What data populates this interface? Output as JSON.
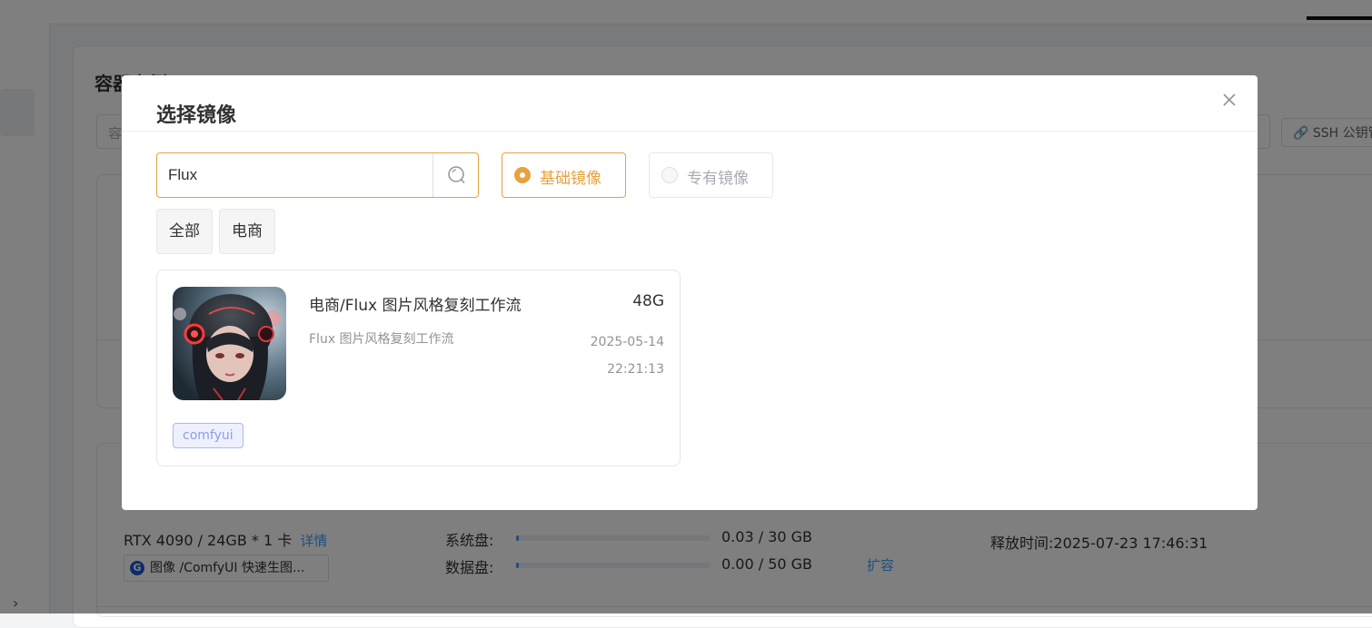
{
  "background": {
    "page_title": "容器实例",
    "filter_placeholder": "容",
    "ssh_button": "SSH 公钥管理",
    "instance": {
      "gpu": "RTX 4090 / 24GB  *  1 卡",
      "detail_link": "详情",
      "image_chip": "图像 /ComfyUI 快速生图...",
      "system_disk_label": "系统盘:",
      "system_disk_value": "0.03 / 30 GB",
      "system_disk_usage": 0.001,
      "data_disk_label": "数据盘:",
      "data_disk_value": "0.00 / 50 GB",
      "data_disk_usage": 0.0,
      "expand_link": "扩容",
      "release_time": "释放时间:2025-07-23 17:46:31"
    }
  },
  "dialog": {
    "title": "选择镜像",
    "search_value": "Flux",
    "radios": [
      {
        "label": "基础镜像",
        "checked": true
      },
      {
        "label": "专有镜像",
        "checked": false
      }
    ],
    "categories": [
      "全部",
      "电商"
    ],
    "results": [
      {
        "title": "电商/Flux 图片风格复刻工作流",
        "size": "48G",
        "description": "Flux 图片风格复刻工作流",
        "date": "2025-05-14",
        "time": "22:21:13",
        "tag": "comfyui"
      }
    ]
  },
  "colors": {
    "accent": "#e6a23c",
    "link": "#409eff",
    "tag_bg": "#eef1fd",
    "tag_text": "#8c9ce8"
  }
}
